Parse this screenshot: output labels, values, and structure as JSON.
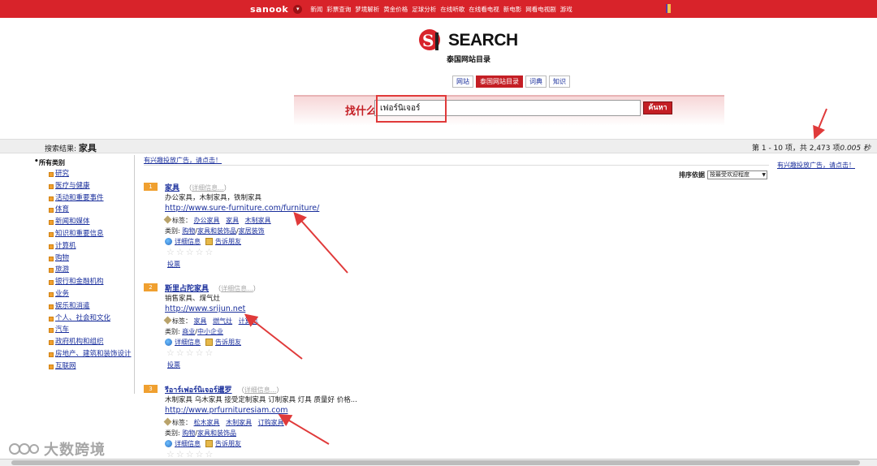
{
  "topbar": {
    "brand": "sanook",
    "links": [
      "新闻",
      "彩票查询",
      "梦境解析",
      "黄金价格",
      "足球分析",
      "在线听歌",
      "在线看电视",
      "新电影",
      "网看电视剧",
      "游戏"
    ]
  },
  "logo": {
    "text": "SEARCH",
    "subtitle": "泰国网站目录"
  },
  "tabs": [
    {
      "label": "网站",
      "active": false
    },
    {
      "label": "泰国网站目录",
      "active": true
    },
    {
      "label": "词典",
      "active": false
    },
    {
      "label": "知识",
      "active": false
    }
  ],
  "search": {
    "label": "找什么",
    "value": "เฟอร์นิเจอร์",
    "button": "ค้นหา"
  },
  "results_header": {
    "prefix": "搜索结果:",
    "query": "家具",
    "count_text": "第 1 - 10 项，共 2,473 项",
    "time": "0.005 秒"
  },
  "sidebar": {
    "heading": "所有类别",
    "items": [
      "研究",
      "医疗与健康",
      "活动和重要事件",
      "体育",
      "新闻和媒体",
      "知识和重要信息",
      "计算机",
      "购物",
      "旅游",
      "银行和金融机构",
      "业务",
      "娱乐和消遣",
      "个人、社会和文化",
      "汽车",
      "政府机构和组织",
      "房地产、建筑和装饰设计",
      "互联网"
    ]
  },
  "ads": {
    "main": "有兴趣投放广告，请点击！",
    "right": "有兴趣投放广告，请点击！"
  },
  "sort": {
    "label": "排序依据",
    "selected": "按最受欢迎程度"
  },
  "labels": {
    "detail": "详细信息...",
    "tags": "标签：",
    "category": "类别:",
    "info": "详细信息",
    "tell_friend": "告诉朋友",
    "vote": "投票",
    "paren_open": "（",
    "paren_close": "）"
  },
  "results": [
    {
      "rank": "1",
      "title": "家具",
      "desc": "办公家具，木制家具，铁制家具",
      "url": "http://www.sure-furniture.com/furniture/",
      "tags": [
        "办公家具",
        "家具",
        "木制家具"
      ],
      "categories": [
        "购物",
        "家具和装饰品",
        "家居装饰"
      ]
    },
    {
      "rank": "2",
      "title": "斯里占陀家具",
      "desc": "销售家具、煤气灶",
      "url": "http://www.srijun.net",
      "tags": [
        "家具",
        "燃气灶",
        "计算机"
      ],
      "categories": [
        "商业",
        "中小企业"
      ]
    },
    {
      "rank": "3",
      "title": "รีอาร์เฟอร์นิเจอร์暹罗",
      "desc": "木制家具 乌木家具 接受定制家具 订制家具 灯具 质量好 价格...",
      "url": "http://www.prfurnituresiam.com",
      "tags": [
        "松木家具",
        "木制家具",
        "订购家具"
      ],
      "categories": [
        "购物",
        "家具和装饰品"
      ]
    }
  ],
  "watermark": {
    "text": "大数跨境"
  },
  "colors": {
    "brand_red": "#d8232a",
    "rank_orange": "#f0a030",
    "link_blue": "#1a2f9c",
    "annotation_red": "#e03a3a"
  }
}
